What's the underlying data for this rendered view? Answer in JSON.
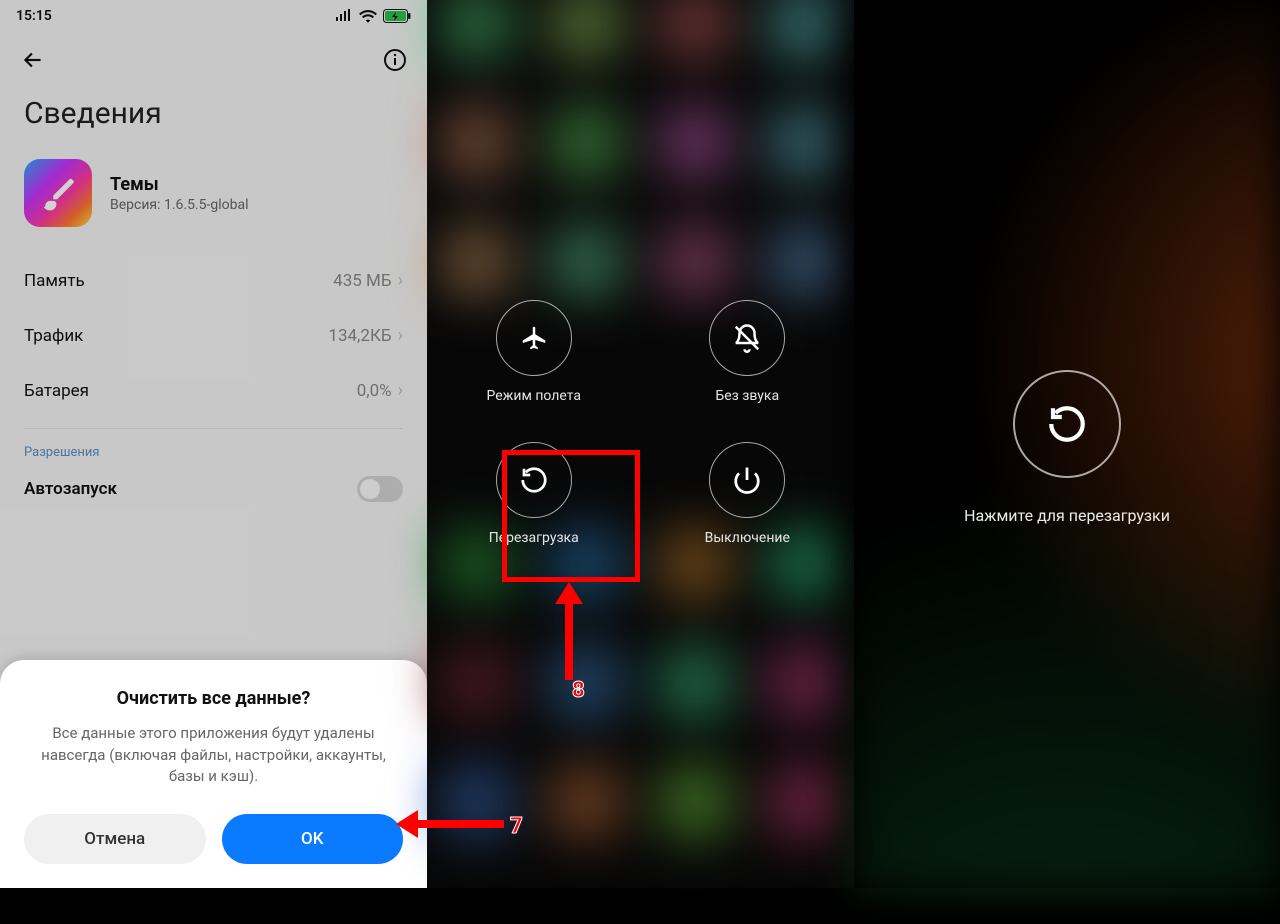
{
  "status": {
    "time": "15:15"
  },
  "page_title": "Сведения",
  "app": {
    "name": "Темы",
    "version": "Версия: 1.6.5.5-global"
  },
  "rows": {
    "memory": {
      "label": "Память",
      "value": "435 МБ"
    },
    "traffic": {
      "label": "Трафик",
      "value": "134,2КБ"
    },
    "battery": {
      "label": "Батарея",
      "value": "0,0%"
    }
  },
  "permissions_label": "Разрешения",
  "autostart_label": "Автозапуск",
  "dialog": {
    "title": "Очистить все данные?",
    "body": "Все данные этого приложения будут удалены навсегда (включая файлы, настройки, аккаунты, базы и кэш).",
    "cancel": "Отмена",
    "ok": "OK"
  },
  "power_menu": {
    "airplane": "Режим полета",
    "silent": "Без звука",
    "reboot": "Перезагрузка",
    "poweroff": "Выключение"
  },
  "reboot_hint": "Нажмите для перезагрузки",
  "annotations": {
    "step7": "7",
    "step8": "8"
  }
}
